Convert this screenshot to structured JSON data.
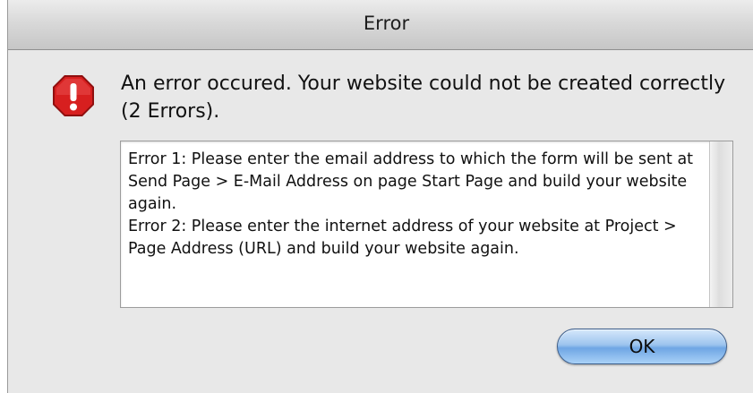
{
  "window": {
    "title": "Error"
  },
  "alert": {
    "icon": "stop-sign-exclamation-icon",
    "icon_color": "#d71f1f",
    "message": "An error occured. Your website could not be created correctly (2 Errors)."
  },
  "details": {
    "errors": [
      "Error 1: Please enter the email address to which the form will be sent at Send Page > E-Mail Address on page Start Page and build your website again.",
      "Error 2: Please enter the internet address of your website at Project > Page Address (URL) and build your website again."
    ]
  },
  "buttons": {
    "ok_label": "OK",
    "ok_color": "#8dbcef"
  }
}
